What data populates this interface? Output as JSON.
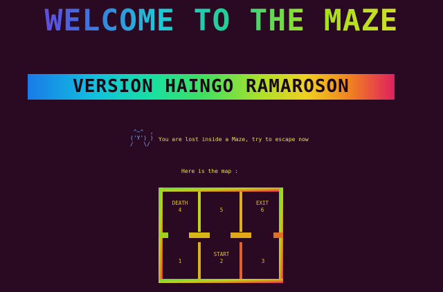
{
  "header": {
    "title": "WELCOME TO THE MAZE",
    "version": "VERSION HAINGO RAMAROSON"
  },
  "intro": {
    "ascii_art": " ^~^  ,\n('Y') )\n/   \\/",
    "message": "You are lost inside a Maze, try to escape now"
  },
  "map": {
    "label": "Here is the map :",
    "rooms": [
      {
        "id": "room-death",
        "name": "DEATH",
        "number": "4"
      },
      {
        "id": "room-5",
        "name": "",
        "number": "5"
      },
      {
        "id": "room-exit",
        "name": "EXIT",
        "number": "6"
      },
      {
        "id": "room-1",
        "name": "",
        "number": "1"
      },
      {
        "id": "room-start",
        "name": "START",
        "number": "2"
      },
      {
        "id": "room-3",
        "name": "",
        "number": "3"
      }
    ]
  },
  "colors": {
    "background": "#2a0a22",
    "text_yellow": "#e6e04a",
    "ascii_blue": "#7fb0ff"
  }
}
